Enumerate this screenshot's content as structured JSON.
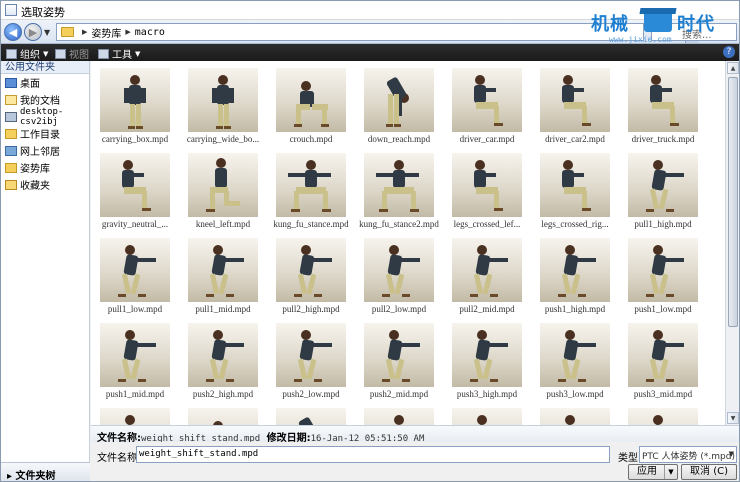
{
  "window": {
    "title": "选取姿势"
  },
  "address": {
    "folder": "姿势库",
    "subfolder": "macro",
    "search_placeholder": "搜索..."
  },
  "toolbar": {
    "organize": "组织",
    "views": "视图",
    "tools": "工具"
  },
  "sidebar": {
    "header": "公用文件夹",
    "items": [
      {
        "label": "桌面",
        "icon": "desktop-icon"
      },
      {
        "label": "我的文档",
        "icon": "documents-icon"
      },
      {
        "label": "desktop-csv2ibj",
        "icon": "computer-icon"
      },
      {
        "label": "工作目录",
        "icon": "folder-icon"
      },
      {
        "label": "网上邻居",
        "icon": "network-icon"
      },
      {
        "label": "姿势库",
        "icon": "folder-icon"
      },
      {
        "label": "收藏夹",
        "icon": "favorites-icon"
      }
    ],
    "footer": "文件夹树"
  },
  "files": [
    {
      "name": "carrying_box.mpd",
      "pose": "stand"
    },
    {
      "name": "carrying_wide_bo...",
      "pose": "stand"
    },
    {
      "name": "crouch.mpd",
      "pose": "crouch"
    },
    {
      "name": "down_reach.mpd",
      "pose": "bend"
    },
    {
      "name": "driver_car.mpd",
      "pose": "sit"
    },
    {
      "name": "driver_car2.mpd",
      "pose": "sit"
    },
    {
      "name": "driver_truck.mpd",
      "pose": "sit"
    },
    {
      "name": "gravity_neutral_...",
      "pose": "sit"
    },
    {
      "name": "kneel_left.mpd",
      "pose": "kneel"
    },
    {
      "name": "kung_fu_stance.mpd",
      "pose": "wide"
    },
    {
      "name": "kung_fu_stance2.mpd",
      "pose": "wide"
    },
    {
      "name": "legs_crossed_lef...",
      "pose": "sit"
    },
    {
      "name": "legs_crossed_rig...",
      "pose": "sit"
    },
    {
      "name": "pull1_high.mpd",
      "pose": "push"
    },
    {
      "name": "pull1_low.mpd",
      "pose": "push"
    },
    {
      "name": "pull1_mid.mpd",
      "pose": "push"
    },
    {
      "name": "pull2_high.mpd",
      "pose": "push"
    },
    {
      "name": "pull2_low.mpd",
      "pose": "push"
    },
    {
      "name": "pull2_mid.mpd",
      "pose": "push"
    },
    {
      "name": "push1_high.mpd",
      "pose": "push"
    },
    {
      "name": "push1_low.mpd",
      "pose": "push"
    },
    {
      "name": "push1_mid.mpd",
      "pose": "push"
    },
    {
      "name": "push2_high.mpd",
      "pose": "push"
    },
    {
      "name": "push2_low.mpd",
      "pose": "push"
    },
    {
      "name": "push2_mid.mpd",
      "pose": "push"
    },
    {
      "name": "push3_high.mpd",
      "pose": "push"
    },
    {
      "name": "push3_low.mpd",
      "pose": "push"
    },
    {
      "name": "push3_mid.mpd",
      "pose": "push"
    },
    {
      "name": "",
      "pose": "push"
    },
    {
      "name": "",
      "pose": "crouch"
    },
    {
      "name": "",
      "pose": "bend"
    },
    {
      "name": "",
      "pose": "stand"
    },
    {
      "name": "",
      "pose": "push"
    },
    {
      "name": "",
      "pose": "push"
    },
    {
      "name": "",
      "pose": "push"
    }
  ],
  "details": {
    "name_label": "文件名称:",
    "name_value": "weight_shift_stand.mpd",
    "date_label": "修改日期:",
    "date_value": "16-Jan-12 05:51:50 AM"
  },
  "bottom": {
    "filename_label": "文件名称:",
    "filename_value": "weight_shift_stand.mpd",
    "type_label": "类型",
    "type_value": "PTC 人体姿势 (*.mpd)",
    "apply": "应用",
    "cancel": "取消 (C)"
  },
  "watermark": {
    "left": "机械",
    "right": "时代",
    "sub": "www.jixie.com"
  }
}
